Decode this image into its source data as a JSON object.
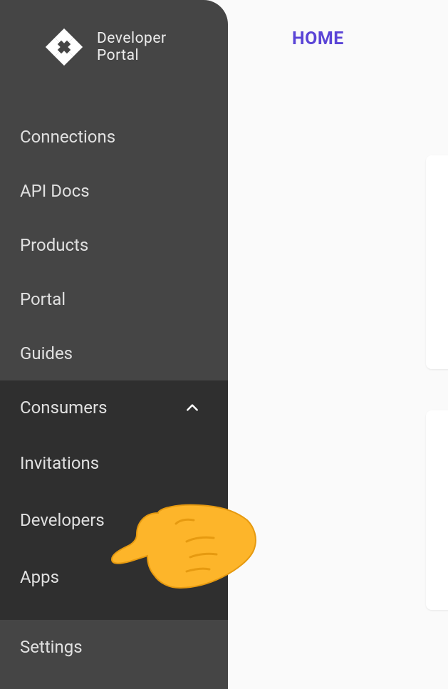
{
  "brand": {
    "line1": "Developer",
    "line2": "Portal"
  },
  "header": {
    "home_label": "HOME"
  },
  "sidebar": {
    "items": [
      {
        "label": "Connections"
      },
      {
        "label": "API Docs"
      },
      {
        "label": "Products"
      },
      {
        "label": "Portal"
      },
      {
        "label": "Guides"
      },
      {
        "label": "Consumers"
      },
      {
        "label": "Settings"
      }
    ],
    "consumers_sub": [
      {
        "label": "Invitations"
      },
      {
        "label": "Developers"
      },
      {
        "label": "Apps"
      }
    ]
  }
}
